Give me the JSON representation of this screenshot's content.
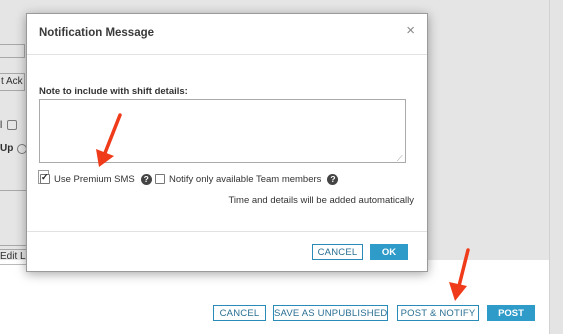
{
  "background": {
    "left_fragments": {
      "ack": "t Ack",
      "checkbox_prefix": "l",
      "up_text": "Up",
      "edit_link": "Edit Lin"
    },
    "actions": {
      "cancel": "CANCEL",
      "save_unpublished": "SAVE AS UNPUBLISHED",
      "post_notify": "POST & NOTIFY",
      "post": "POST"
    }
  },
  "modal": {
    "title": "Notification Message",
    "close_glyph": "×",
    "note_label": "Note to include with shift details:",
    "note_value": "",
    "options": [
      {
        "label": "Use Premium SMS",
        "checked": true
      },
      {
        "label": "Notify only available Team members",
        "checked": false
      }
    ],
    "help_glyph": "?",
    "auto_note": "Time and details will be added automatically",
    "buttons": {
      "cancel": "CANCEL",
      "ok": "OK"
    }
  },
  "colors": {
    "accent": "#2e9bc9",
    "arrow": "#f03b1a"
  }
}
